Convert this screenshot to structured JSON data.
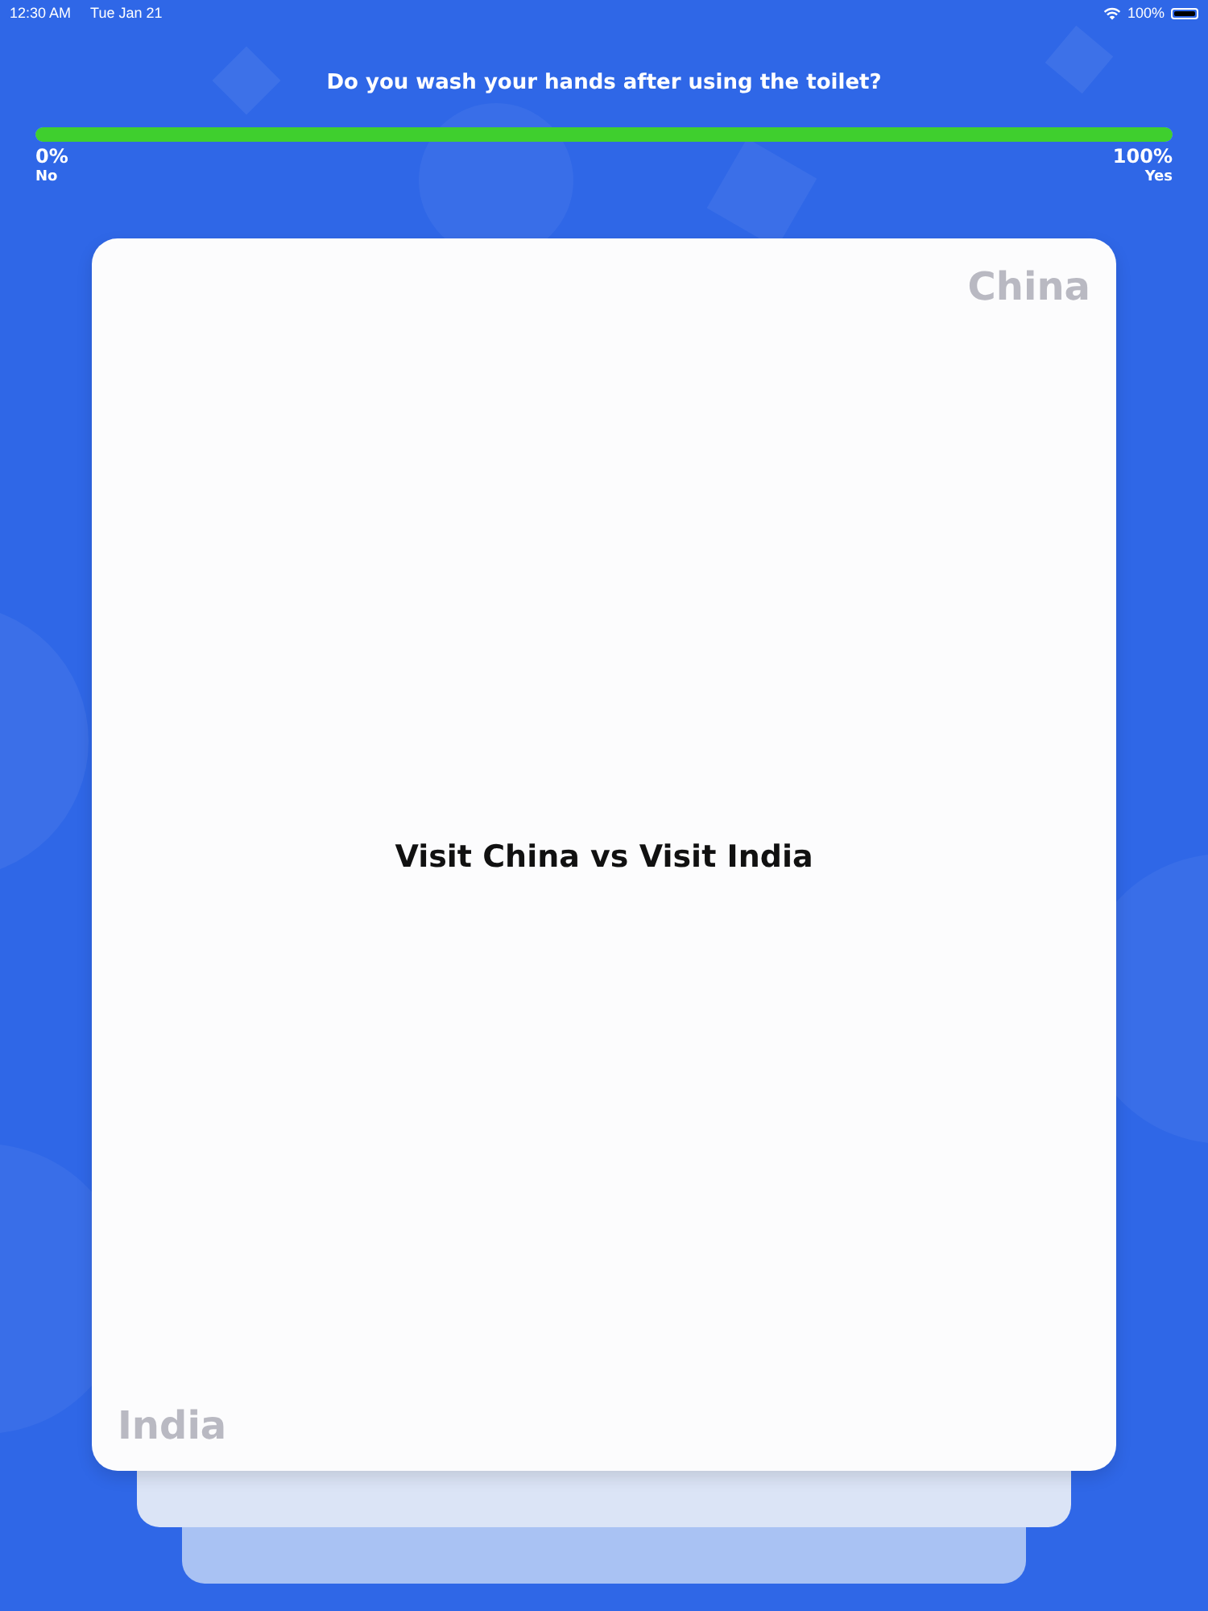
{
  "status_bar": {
    "time": "12:30 AM",
    "date": "Tue Jan 21",
    "battery": "100%"
  },
  "question": {
    "text": "Do you wash your hands after using the toilet?",
    "level": 1.0,
    "left": {
      "percent": "0%",
      "label": "No"
    },
    "right": {
      "percent": "100%",
      "label": "Yes"
    }
  },
  "card": {
    "title": "Visit China vs Visit India",
    "right_tag": "China",
    "left_tag": "India"
  }
}
